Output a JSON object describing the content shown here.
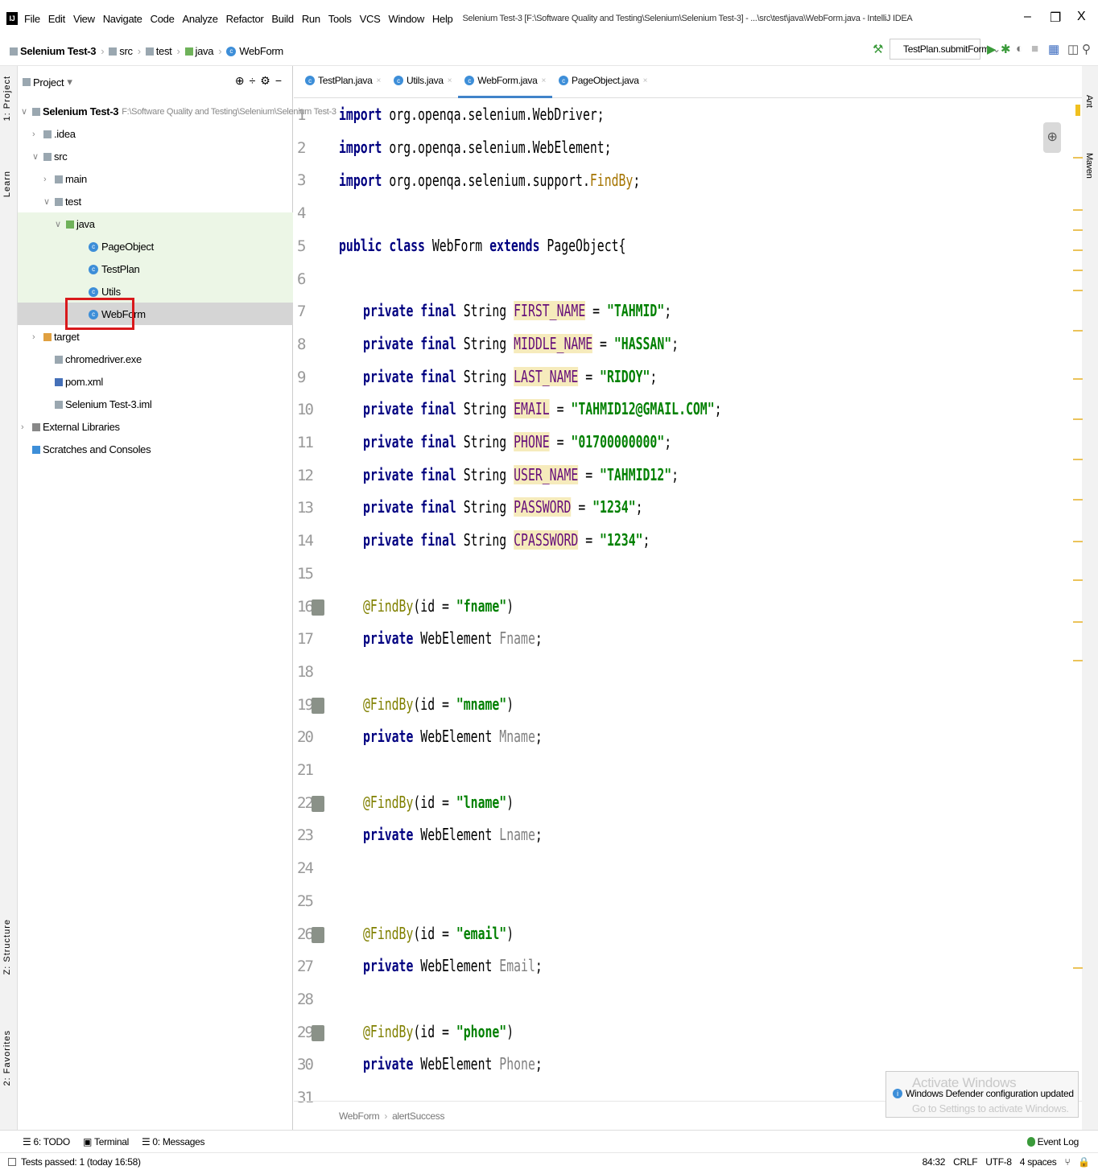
{
  "window": {
    "title": "Selenium Test-3 [F:\\Software Quality and Testing\\Selenium\\Selenium Test-3] - ...\\src\\test\\java\\WebForm.java - IntelliJ IDEA",
    "app_icon_text": "IJ",
    "minimize": "–",
    "maximize": "❐",
    "close": "X"
  },
  "menu": [
    "File",
    "Edit",
    "View",
    "Navigate",
    "Code",
    "Analyze",
    "Refactor",
    "Build",
    "Run",
    "Tools",
    "VCS",
    "Window",
    "Help"
  ],
  "navbar": {
    "crumbs": [
      "Selenium Test-3",
      "src",
      "test",
      "java",
      "WebForm"
    ],
    "run_config": "TestPlan.submitForm"
  },
  "left_strip": {
    "project": "1: Project",
    "learn": "Learn",
    "structure": "Z: Structure",
    "favorites": "2: Favorites"
  },
  "right_strip": {
    "ant": "Ant",
    "maven": "Maven"
  },
  "project": {
    "header": "Project",
    "tree": [
      {
        "label": "Selenium Test-3",
        "path": "F:\\Software Quality and Testing\\Selenium\\Selenium Test-3",
        "arrow": "∨",
        "icon": "folder"
      },
      {
        "label": ".idea",
        "arrow": "›",
        "icon": "folder"
      },
      {
        "label": "src",
        "arrow": "∨",
        "icon": "folder"
      },
      {
        "label": "main",
        "arrow": "›",
        "icon": "folder"
      },
      {
        "label": "test",
        "arrow": "∨",
        "icon": "folder"
      },
      {
        "label": "java",
        "arrow": "∨",
        "icon": "folder-green"
      },
      {
        "label": "PageObject",
        "arrow": "",
        "icon": "class"
      },
      {
        "label": "TestPlan",
        "arrow": "",
        "icon": "class"
      },
      {
        "label": "Utils",
        "arrow": "",
        "icon": "class"
      },
      {
        "label": "WebForm",
        "arrow": "",
        "icon": "class"
      },
      {
        "label": "target",
        "arrow": "›",
        "icon": "folder-orange"
      },
      {
        "label": "chromedriver.exe",
        "arrow": "",
        "icon": "file"
      },
      {
        "label": "pom.xml",
        "arrow": "",
        "icon": "maven"
      },
      {
        "label": "Selenium Test-3.iml",
        "arrow": "",
        "icon": "file"
      },
      {
        "label": "External Libraries",
        "arrow": "›",
        "icon": "library"
      },
      {
        "label": "Scratches and Consoles",
        "arrow": "",
        "icon": "scratch"
      }
    ]
  },
  "tabs": [
    {
      "label": "TestPlan.java",
      "active": false
    },
    {
      "label": "Utils.java",
      "active": false
    },
    {
      "label": "WebForm.java",
      "active": true
    },
    {
      "label": "PageObject.java",
      "active": false
    }
  ],
  "code": {
    "line_numbers": [
      "1",
      "2",
      "3",
      "4",
      "5",
      "6",
      "7",
      "8",
      "9",
      "10",
      "11",
      "12",
      "13",
      "14",
      "15",
      "16",
      "17",
      "18",
      "19",
      "20",
      "21",
      "22",
      "23",
      "24",
      "25",
      "26",
      "27",
      "28",
      "29",
      "30",
      "31"
    ],
    "import1": {
      "kw": "import",
      "rest": " org.openqa.selenium.WebDriver;"
    },
    "import2": {
      "kw": "import",
      "rest": " org.openqa.selenium.WebElement;"
    },
    "import3": {
      "kw": "import",
      "rest": " org.openqa.selenium.support.",
      "cls": "FindBy",
      ";": ";"
    },
    "class_decl": {
      "kw1": "public class",
      "name": " WebForm ",
      "kw2": "extends",
      "rest": " PageObject{"
    },
    "fields": [
      {
        "name": "FIRST_NAME",
        "value": "\"TAHMID\""
      },
      {
        "name": "MIDDLE_NAME",
        "value": "\"HASSAN\""
      },
      {
        "name": "LAST_NAME",
        "value": "\"RIDOY\""
      },
      {
        "name": "EMAIL",
        "value": "\"TAHMID12@GMAIL.COM\""
      },
      {
        "name": "PHONE",
        "value": "\"01700000000\""
      },
      {
        "name": "USER_NAME",
        "value": "\"TAHMID12\""
      },
      {
        "name": "PASSWORD",
        "value": "\"1234\""
      },
      {
        "name": "CPASSWORD",
        "value": "\"1234\""
      }
    ],
    "field_kw": "private final",
    "field_type": " String ",
    "annotations": [
      {
        "id": "\"fname\"",
        "var": "Fname"
      },
      {
        "id": "\"mname\"",
        "var": "Mname"
      },
      {
        "id": "\"lname\"",
        "var": "Lname"
      },
      {
        "id": "\"email\"",
        "var": "Email"
      },
      {
        "id": "\"phone\"",
        "var": "Phone"
      }
    ],
    "ann_name": "@FindBy",
    "ann_arg": "(id = ",
    "elem_kw": "private",
    "elem_type": " WebElement "
  },
  "editor_breadcrumb": [
    "WebForm",
    "alertSuccess"
  ],
  "notification": {
    "watermark1": "Activate Windows",
    "text": "Windows Defender configuration updated",
    "watermark2": "Go to Settings to activate Windows."
  },
  "bottom_tools": [
    "6: TODO",
    "Terminal",
    "0: Messages"
  ],
  "event_log": "Event Log",
  "status": {
    "left": "Tests passed: 1 (today 16:58)",
    "position": "84:32",
    "line_sep": "CRLF",
    "encoding": "UTF-8",
    "indent": "4 spaces"
  }
}
